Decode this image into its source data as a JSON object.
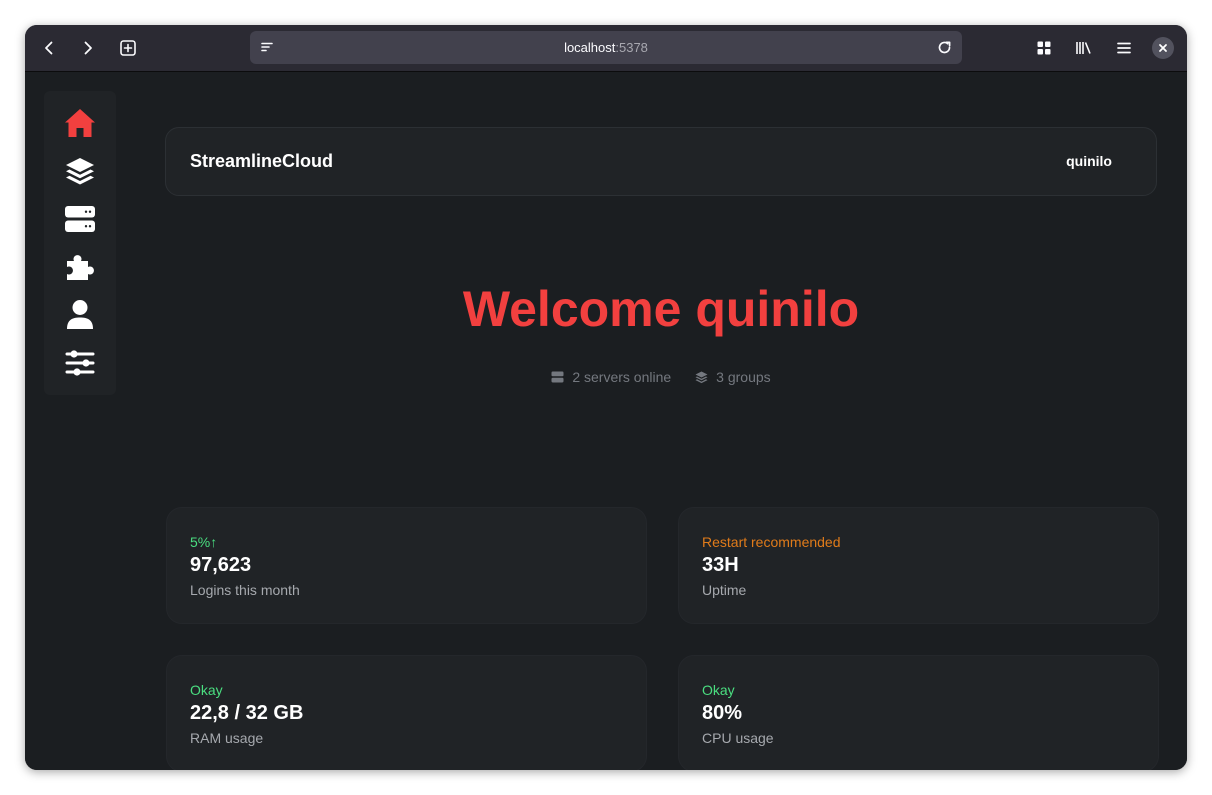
{
  "browser": {
    "url_host": "localhost",
    "url_port": ":5378"
  },
  "sidebar": {
    "items": [
      {
        "name": "home",
        "icon": "home-icon",
        "active": true
      },
      {
        "name": "groups",
        "icon": "layers-icon"
      },
      {
        "name": "servers",
        "icon": "server-icon"
      },
      {
        "name": "plugins",
        "icon": "puzzle-icon"
      },
      {
        "name": "account",
        "icon": "user-icon"
      },
      {
        "name": "settings",
        "icon": "sliders-icon"
      }
    ]
  },
  "header": {
    "brand": "StreamlineCloud",
    "username": "quinilo"
  },
  "hero": {
    "welcome": "Welcome quinilo",
    "servers_online": "2 servers online",
    "groups": "3 groups"
  },
  "cards": [
    {
      "status": "5%↑",
      "status_color": "#4ade80",
      "value": "97,623",
      "label": "Logins this month"
    },
    {
      "status": "Restart recommended",
      "status_color": "#e07b1a",
      "value": "33H",
      "label": "Uptime"
    },
    {
      "status": "Okay",
      "status_color": "#4ade80",
      "value": "22,8 / 32 GB",
      "label": "RAM usage"
    },
    {
      "status": "Okay",
      "status_color": "#4ade80",
      "value": "80%",
      "label": "CPU usage"
    }
  ],
  "colors": {
    "accent": "#f2403f",
    "background": "#1b1e21",
    "panel": "#202326"
  }
}
